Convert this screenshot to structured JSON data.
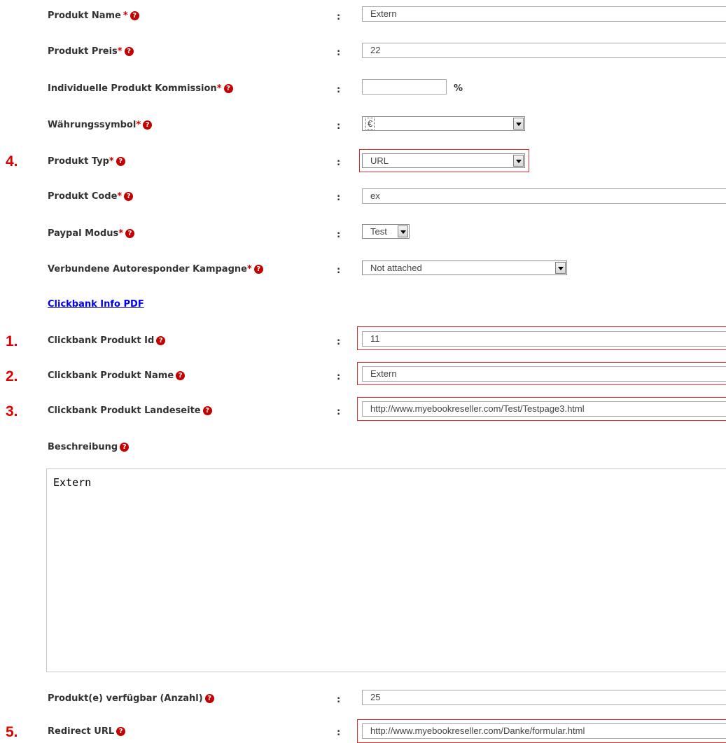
{
  "help_glyph": "?",
  "required_mark": "*",
  "colon": ":",
  "form": {
    "product_name": {
      "label": "Produkt Name",
      "value": "Extern"
    },
    "product_price": {
      "label": "Produkt Preis",
      "value": "22"
    },
    "commission": {
      "label": "Individuelle Produkt Kommission",
      "value": "",
      "unit": "%"
    },
    "currency": {
      "label": "Währungssymbol",
      "selected": "€"
    },
    "product_type": {
      "label": "Produkt Typ",
      "selected": "URL",
      "marker": "4."
    },
    "product_code": {
      "label": "Produkt Code",
      "value": "ex"
    },
    "paypal_mode": {
      "label": "Paypal Modus",
      "selected": "Test"
    },
    "autoresponder": {
      "label": "Verbundene Autoresponder Kampagne",
      "selected": "Not attached"
    },
    "clickbank_link": "Clickbank Info PDF",
    "clickbank_id": {
      "label": "Clickbank Produkt Id",
      "value": "11",
      "marker": "1."
    },
    "clickbank_name": {
      "label": "Clickbank Produkt Name",
      "value": "Extern",
      "marker": "2."
    },
    "clickbank_landing": {
      "label": "Clickbank Produkt Landeseite",
      "value": "http://www.myebookreseller.com/Test/Testpage3.html",
      "marker": "3."
    },
    "description": {
      "label": "Beschreibung",
      "value": "Extern"
    },
    "available": {
      "label": "Produkt(e) verfügbar (Anzahl)",
      "value": "25"
    },
    "redirect_url": {
      "label": "Redirect URL",
      "value": "http://www.myebookreseller.com/Danke/formular.html",
      "marker": "5."
    }
  },
  "colors": {
    "annotation_red": "#e00000",
    "link_blue": "#0000ee",
    "required_red": "#cc0000"
  }
}
